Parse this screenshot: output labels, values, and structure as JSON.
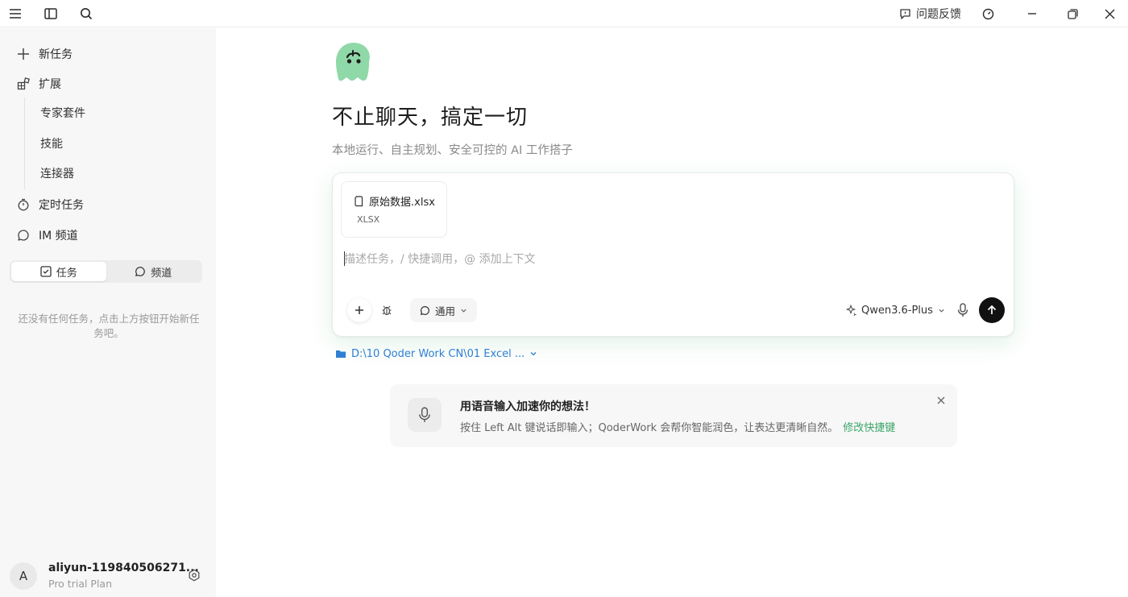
{
  "titlebar": {
    "feedback_label": "问题反馈"
  },
  "sidebar": {
    "nav": {
      "new_task": "新任务",
      "extensions": "扩展",
      "expert_kit": "专家套件",
      "skills": "技能",
      "connectors": "连接器",
      "scheduled": "定时任务",
      "im_channel": "IM 频道"
    },
    "tabs": {
      "tasks": "任务",
      "channels": "频道",
      "active": "tasks"
    },
    "empty_hint": "还没有任何任务，点击上方按钮开始新任务吧。",
    "user": {
      "avatar_letter": "A",
      "name": "aliyun-119840506271...",
      "plan": "Pro trial Plan"
    }
  },
  "main": {
    "headline": "不止聊天，搞定一切",
    "subline": "本地运行、自主规划、安全可控的 AI 工作搭子",
    "composer": {
      "attachment": {
        "name": "原始数据.xlsx",
        "type": "XLSX"
      },
      "input_placeholder": "描述任务，/ 快捷调用，@ 添加上下文",
      "input_value": "",
      "mode_label": "通用",
      "model_label": "Qwen3.6-Plus"
    },
    "workspace_path": "D:\\10 Qoder Work CN\\01 Excel ...",
    "voice_tip": {
      "title": "用语音输入加速你的想法！",
      "body": "按住 Left Alt 键说话即输入；QoderWork 会帮你智能润色，让表达更清晰自然。",
      "link": "修改快捷键"
    }
  },
  "colors": {
    "accent_green": "#3aa668",
    "logo_green": "#8fd9a8",
    "path_blue": "#2d7fd3",
    "send_button": "#111111"
  },
  "icons": [
    "menu-icon",
    "sidebar-toggle-icon",
    "search-icon",
    "feedback-icon",
    "gauge-icon",
    "minimize-icon",
    "restore-icon",
    "close-icon",
    "plus-icon",
    "extension-icon",
    "timer-icon",
    "chat-icon",
    "checkbox-icon",
    "file-icon",
    "bug-icon",
    "sparkle-icon",
    "chevron-down-icon",
    "microphone-icon",
    "arrow-up-icon",
    "folder-icon",
    "settings-icon"
  ]
}
